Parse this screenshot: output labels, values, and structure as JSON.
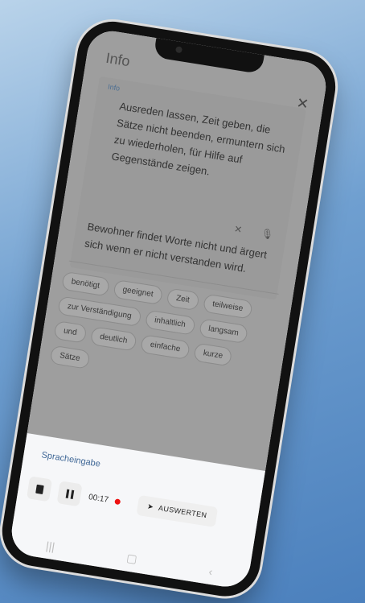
{
  "header": {
    "title": "Info"
  },
  "card": {
    "label": "Info",
    "text_main": "Ausreden lassen, Zeit geben, die Sätze nicht beenden, ermuntern sich zu wiederholen, für Hilfe auf Gegenstände zeigen.",
    "text_secondary": "Bewohner findet Worte nicht und ärgert sich wenn er nicht verstanden wird."
  },
  "tags": [
    "benötigt",
    "geeignet",
    "Zeit",
    "teilweise",
    "zur Verständigung",
    "inhaltlich",
    "langsam",
    "und",
    "deutlich",
    "einfache",
    "kurze",
    "Sätze"
  ],
  "voice": {
    "label": "Spracheingabe",
    "time": "00:17",
    "evaluate_label": "AUSWERTEN"
  },
  "icons": {
    "close": "close-icon",
    "stop": "stop-icon",
    "pause": "pause-icon",
    "send": "send-icon"
  }
}
